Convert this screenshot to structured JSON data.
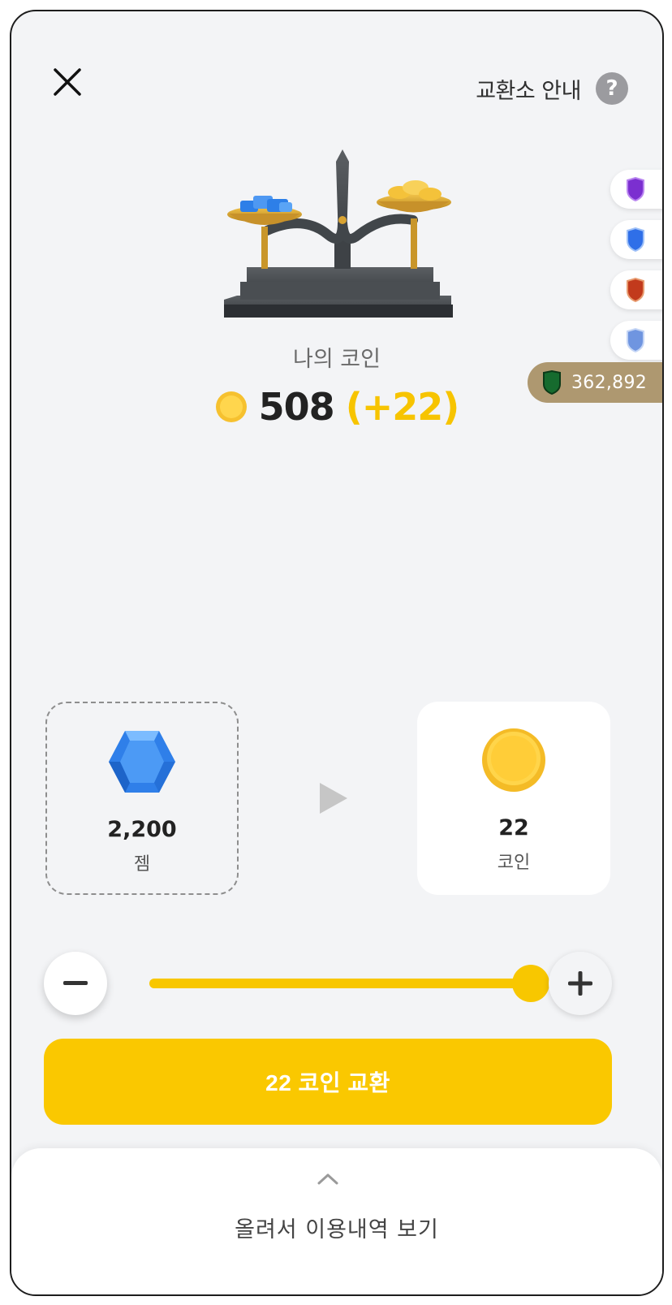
{
  "header": {
    "guide_label": "교환소 안내",
    "help_icon_glyph": "?"
  },
  "icons": {
    "close": "close-icon",
    "help": "help-icon",
    "hero": "balance-scale-icon",
    "gem": "gem-icon",
    "coin": "coin-icon",
    "arrow": "play-arrow-icon",
    "minus": "minus-icon",
    "plus": "plus-icon",
    "chevron": "chevron-up-icon"
  },
  "side_tabs": [
    {
      "icon": "purple-shield-icon",
      "color": "#7b2fd0"
    },
    {
      "icon": "blue-shield-icon",
      "color": "#2f6fe8"
    },
    {
      "icon": "red-shield-icon",
      "color": "#c23a1c"
    },
    {
      "icon": "lightblue-shield-icon",
      "color": "#6f95e0"
    }
  ],
  "score": {
    "icon": "green-shield-icon",
    "value": "362,892"
  },
  "balance": {
    "label": "나의 코인",
    "coins": "508",
    "delta": "(+22)"
  },
  "exchange": {
    "from_value": "2,200",
    "from_unit": "젬",
    "to_value": "22",
    "to_unit": "코인",
    "slider_fraction": 1.0,
    "button_label": "22 코인 교환"
  },
  "history": {
    "label": "올려서 이용내역 보기"
  },
  "colors": {
    "accent": "#fac800",
    "delta": "#f7c400",
    "score_pill": "#ae9870",
    "background": "#f3f4f6"
  }
}
